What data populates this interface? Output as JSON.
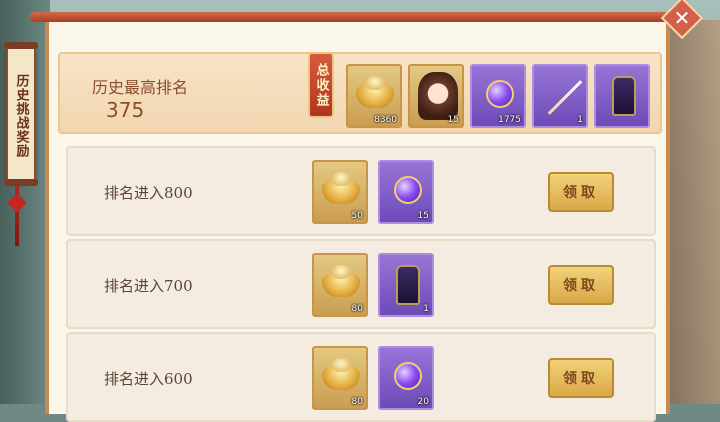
{
  "side_tab": {
    "label": "历史挑战奖励"
  },
  "close_button": {
    "label": "✕"
  },
  "header": {
    "title": "历史最高排名",
    "rank": "375",
    "total_tag": "总收益",
    "items": [
      {
        "icon": "gold-ingot-icon",
        "count": "8360"
      },
      {
        "icon": "hero-portrait-icon",
        "count": "15"
      },
      {
        "icon": "purple-orb-icon",
        "count": "1775"
      },
      {
        "icon": "spear-icon",
        "count": "1"
      },
      {
        "icon": "armor-icon",
        "count": ""
      }
    ]
  },
  "rows": [
    {
      "label": "排名进入800",
      "items": [
        {
          "icon": "gold-ingot-icon",
          "count": "50"
        },
        {
          "icon": "purple-orb-icon",
          "count": "15"
        }
      ],
      "button": "领取"
    },
    {
      "label": "排名进入700",
      "items": [
        {
          "icon": "gold-ingot-icon",
          "count": "80"
        },
        {
          "icon": "armor-icon",
          "count": "1"
        }
      ],
      "button": "领取"
    },
    {
      "label": "排名进入600",
      "items": [
        {
          "icon": "gold-ingot-icon",
          "count": "80"
        },
        {
          "icon": "purple-orb-icon",
          "count": "20"
        }
      ],
      "button": "领取"
    }
  ],
  "colors": {
    "panel": "#fbf6ea",
    "accent_red": "#b0351f",
    "button_gold": "#d9a847"
  }
}
